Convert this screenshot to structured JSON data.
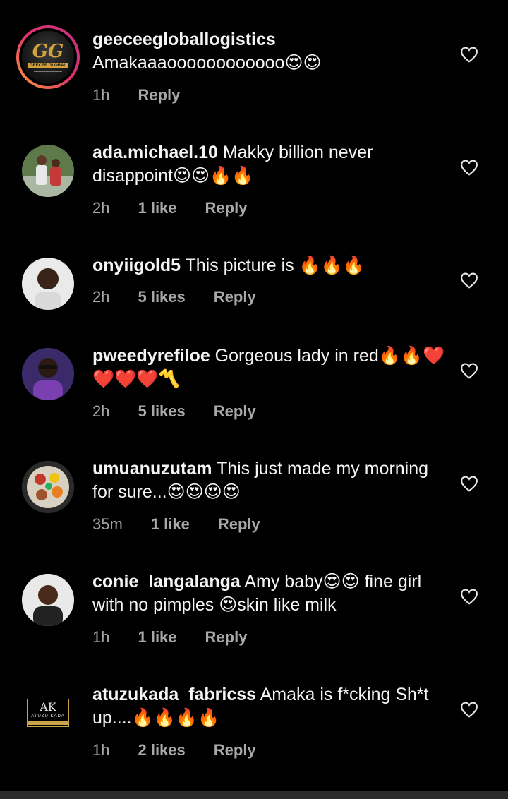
{
  "comments": [
    {
      "username": "geeceegloballogistics",
      "text": "Amakaaaoooooooooooo😍😍",
      "time": "1h",
      "likes": "",
      "reply": "Reply",
      "avatar": "logo-avatar",
      "avatar_text": "GG",
      "avatar_band": "GEECEE GLOBAL"
    },
    {
      "username": "ada.michael.10",
      "text": " Makky billion never disappoint😍😍🔥🔥",
      "time": "2h",
      "likes": "1 like",
      "reply": "Reply",
      "avatar": "photo-avatar"
    },
    {
      "username": "onyiigold5",
      "text": " This picture is 🔥🔥🔥",
      "time": "2h",
      "likes": "5 likes",
      "reply": "Reply",
      "avatar": "photo-avatar"
    },
    {
      "username": "pweedyrefiloe",
      "text": " Gorgeous lady in red🔥🔥❤️❤️❤️❤️〽️",
      "time": "2h",
      "likes": "5 likes",
      "reply": "Reply",
      "avatar": "photo-avatar"
    },
    {
      "username": "umuanuzutam",
      "text": " This just made my morning for sure...😍😍😍😍",
      "time": "35m",
      "likes": "1 like",
      "reply": "Reply",
      "avatar": "photo-avatar"
    },
    {
      "username": "conie_langalanga",
      "text": " Amy baby😍😍 fine girl with no pimples 😍skin like milk",
      "time": "1h",
      "likes": "1 like",
      "reply": "Reply",
      "avatar": "photo-avatar"
    },
    {
      "username": "atuzukada_fabricss",
      "text": " Amaka is f*cking Sh*t up....🔥🔥🔥🔥",
      "time": "1h",
      "likes": "2 likes",
      "reply": "Reply",
      "avatar": "logo-avatar",
      "avatar_text": "AK",
      "avatar_band": "ATUZU KADA"
    }
  ],
  "icons": {
    "like": "heart-outline-icon"
  },
  "colors": {
    "background": "#000000",
    "text": "#f5f5f5",
    "meta": "#a8a8a8",
    "story_ring": "#e1306c"
  }
}
